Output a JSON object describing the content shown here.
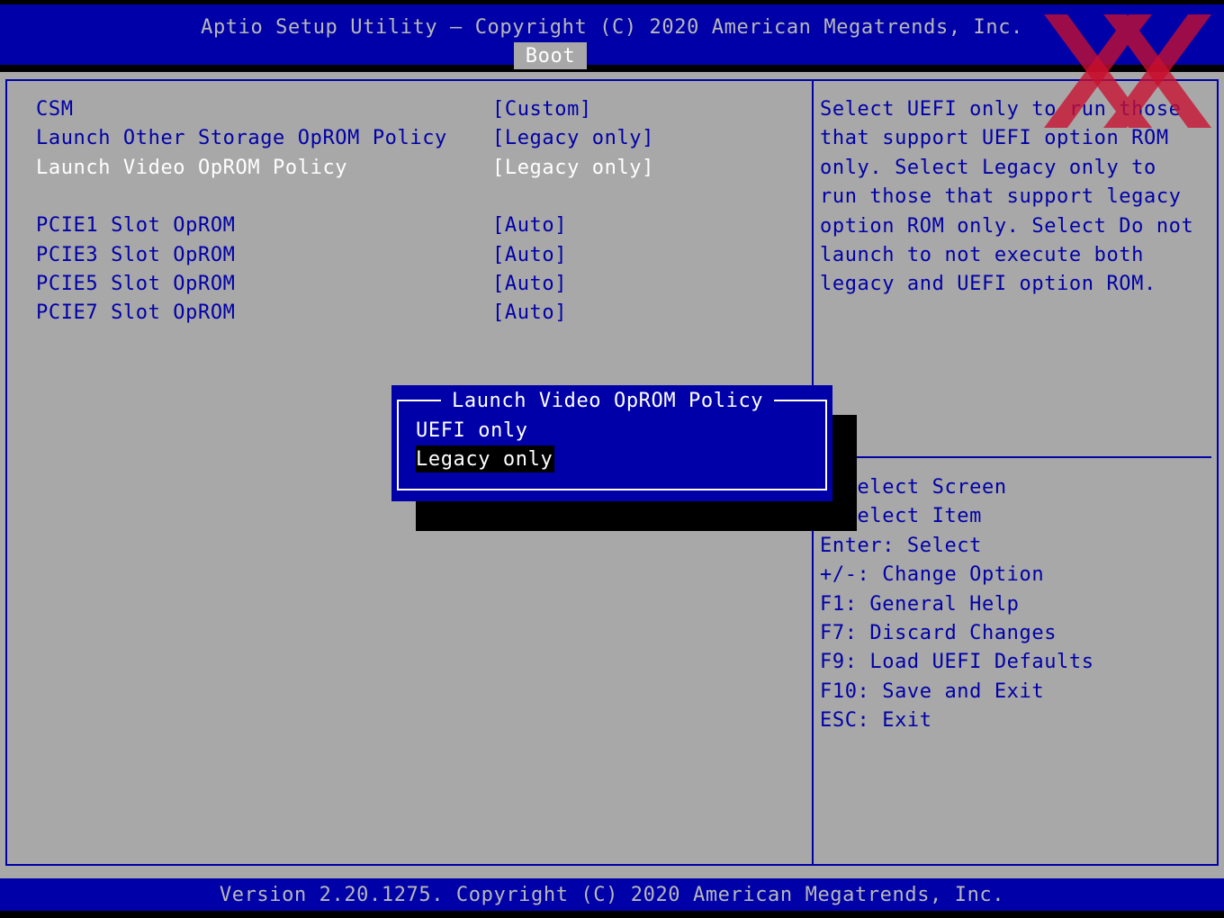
{
  "header": {
    "title": "Aptio Setup Utility – Copyright (C) 2020 American Megatrends, Inc.",
    "active_tab": "Boot"
  },
  "settings": [
    {
      "label": "CSM",
      "value": "[Custom]"
    },
    {
      "label": "Launch Other Storage OpROM Policy",
      "value": "[Legacy only]"
    },
    {
      "label": "Launch Video OpROM Policy",
      "value": "[Legacy only]",
      "selected": true
    },
    {
      "label": "PCIE1 Slot OpROM",
      "value": "[Auto]"
    },
    {
      "label": "PCIE3 Slot OpROM",
      "value": "[Auto]"
    },
    {
      "label": "PCIE5 Slot OpROM",
      "value": "[Auto]"
    },
    {
      "label": "PCIE7 Slot OpROM",
      "value": "[Auto]"
    }
  ],
  "help": {
    "lines": [
      "Select UEFI only to run those",
      "that support UEFI option ROM",
      "only. Select Legacy only to",
      "run those that support legacy",
      "option ROM only. Select Do not",
      "launch to not execute both",
      "legacy and UEFI option ROM."
    ]
  },
  "keys": [
    "  Select Screen",
    "  Select Item",
    "Enter: Select",
    "+/-: Change Option",
    "F1: General Help",
    "F7: Discard Changes",
    "F9: Load UEFI Defaults",
    "F10: Save and Exit",
    "ESC: Exit"
  ],
  "popup": {
    "title": "Launch Video OpROM Policy",
    "options": [
      "UEFI only",
      "Legacy only"
    ],
    "selected": "Legacy only"
  },
  "footer": {
    "text": "Version 2.20.1275. Copyright (C) 2020 American Megatrends, Inc."
  },
  "colors": {
    "bios_blue": "#0000a8",
    "bios_gray": "#a8a8a8",
    "highlight_white": "#ffffff",
    "logo_red": "#c8102e"
  },
  "icons": {
    "watermark": "xx-logo-icon"
  }
}
